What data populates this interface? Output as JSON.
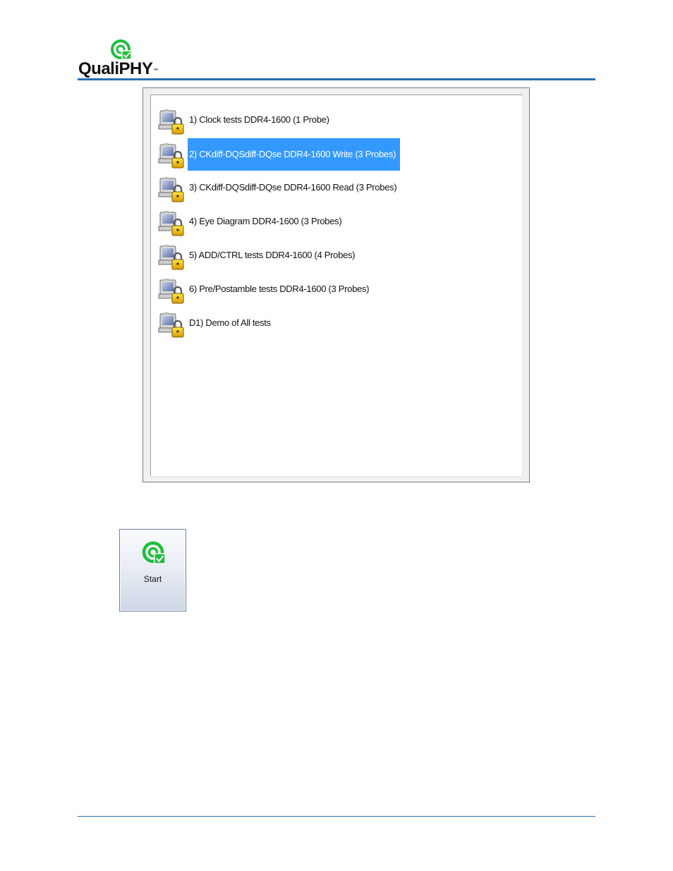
{
  "header": {
    "logo_text": "QualiPHY",
    "logo_tm": "™",
    "brand_color": "#2a6fb5",
    "logo_mark_color": "#1dbf3a"
  },
  "test_list": {
    "items": [
      {
        "label": "1) Clock tests DDR4-1600 (1 Probe)",
        "icon": "locked-computer-icon",
        "selected": false
      },
      {
        "label": "2) CKdiff-DQSdiff-DQse DDR4-1600 Write (3 Probes)",
        "icon": "locked-computer-icon",
        "selected": true
      },
      {
        "label": "3) CKdiff-DQSdiff-DQse DDR4-1600 Read (3 Probes)",
        "icon": "locked-computer-icon",
        "selected": false
      },
      {
        "label": "4) Eye Diagram DDR4-1600 (3 Probes)",
        "icon": "locked-computer-icon",
        "selected": false
      },
      {
        "label": "5) ADD/CTRL tests DDR4-1600 (4 Probes)",
        "icon": "locked-computer-icon",
        "selected": false
      },
      {
        "label": "6) Pre/Postamble tests DDR4-1600 (3 Probes)",
        "icon": "locked-computer-icon",
        "selected": false
      },
      {
        "label": "D1) Demo of All tests",
        "icon": "locked-computer-icon",
        "selected": false
      }
    ],
    "selection_color": "#3399ff"
  },
  "start_button": {
    "label": "Start",
    "icon": "qualiphy-start-icon"
  }
}
